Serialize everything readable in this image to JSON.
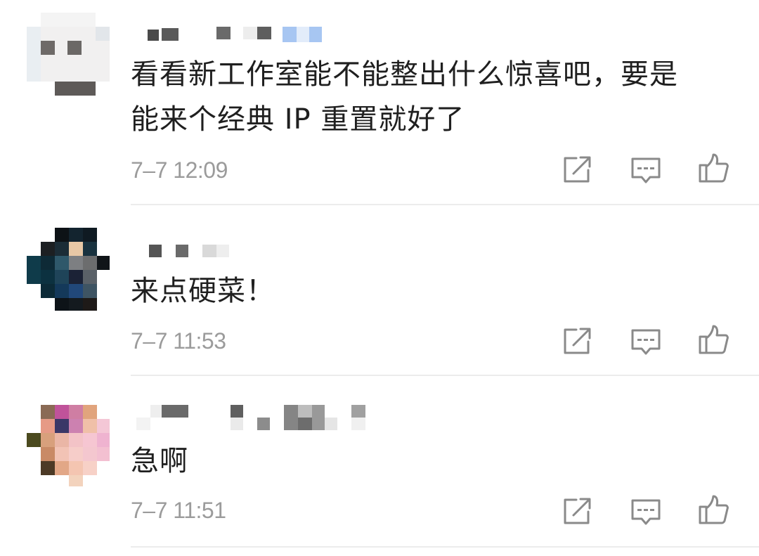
{
  "comments": [
    {
      "text_line1": "看看新工作室能不能整出什么惊喜吧，要是",
      "text_line2": "能来个经典 IP 重置就好了",
      "time": "7–7 12:09"
    },
    {
      "text_line1": "来点硬菜！",
      "time": "7–7 11:53"
    },
    {
      "text_line1": "急啊",
      "time": "7–7 11:51"
    }
  ],
  "icons": {
    "share": "share-icon",
    "reply": "comment-icon",
    "like": "thumbs-up-icon"
  },
  "colors": {
    "text": "#1f1f1f",
    "meta": "#9b9b9b",
    "icon": "#8a8a8a",
    "divider": "#ececec"
  }
}
